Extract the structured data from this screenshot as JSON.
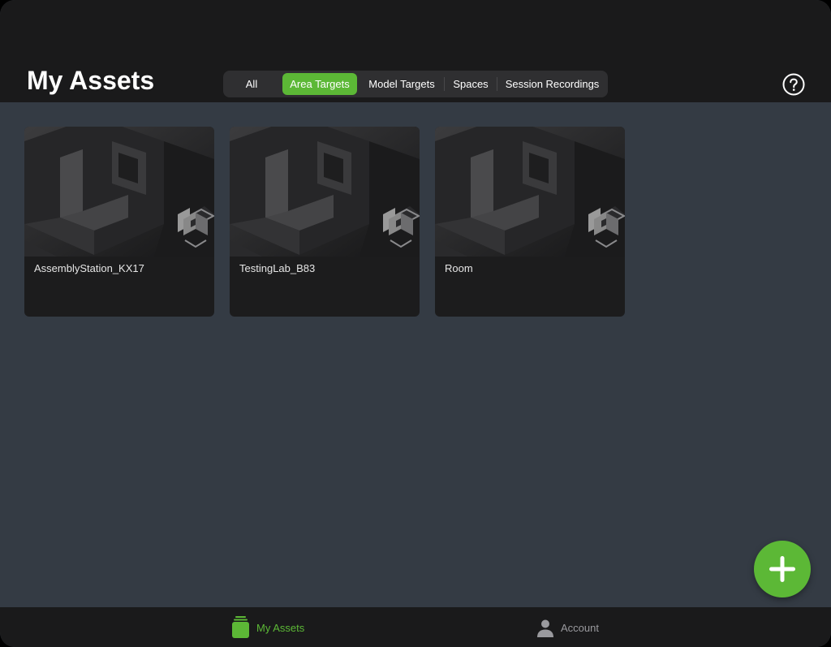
{
  "header": {
    "title": "My Assets"
  },
  "filters": {
    "items": [
      {
        "label": "All",
        "active": false
      },
      {
        "label": "Area Targets",
        "active": true
      },
      {
        "label": "Model Targets",
        "active": false
      },
      {
        "label": "Spaces",
        "active": false
      },
      {
        "label": "Session Recordings",
        "active": false
      }
    ]
  },
  "help": {
    "icon": "help-circle-icon"
  },
  "assets": [
    {
      "name": "AssemblyStation_KX17",
      "type_icon": "area-target-icon"
    },
    {
      "name": "TestingLab_B83",
      "type_icon": "area-target-icon"
    },
    {
      "name": "Room",
      "type_icon": "area-target-icon"
    }
  ],
  "fab": {
    "icon": "plus-icon"
  },
  "tabbar": {
    "items": [
      {
        "label": "My Assets",
        "icon": "stack-icon",
        "active": true
      },
      {
        "label": "Account",
        "icon": "person-icon",
        "active": false
      }
    ]
  },
  "colors": {
    "accent": "#5cb836",
    "header_bg": "#1a1a1b",
    "content_bg": "#343b44",
    "card_bg": "#1c1c1d",
    "inactive_text": "#9a9a9e"
  }
}
